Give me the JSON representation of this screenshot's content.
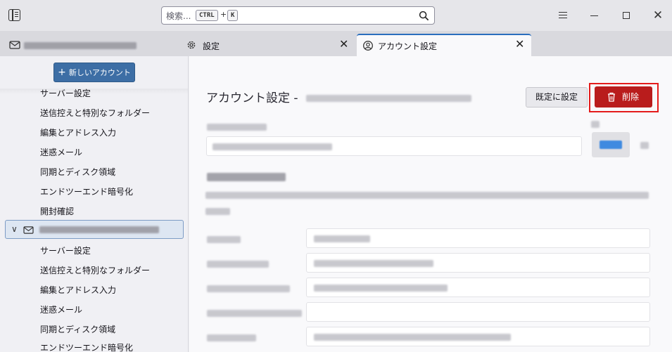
{
  "titlebar": {
    "search": {
      "placeholder": "検索...",
      "shortcut_ctrl": "CTRL",
      "shortcut_plus": "+",
      "shortcut_key": "K"
    },
    "icons": [
      "app-menu-icon",
      "search-icon",
      "hamburger-icon",
      "minimize-icon",
      "maximize-icon",
      "close-icon"
    ],
    "close_glyph": "✕"
  },
  "tabs": [
    {
      "label": "",
      "icon": "mail-account-icon",
      "close": ""
    },
    {
      "label": "設定",
      "icon": "gear-icon",
      "close": "✕"
    },
    {
      "label": "アカウント設定",
      "icon": "account-icon",
      "close": "✕",
      "active": true
    }
  ],
  "sidebar": {
    "new_account_button": "新しいアカウント",
    "plus_glyph": "+",
    "chevron": "∨",
    "group1": [
      "サーバー設定",
      "送信控えと特別なフォルダー",
      "編集とアドレス入力",
      "迷惑メール",
      "同期とディスク領域",
      "エンドツーエンド暗号化",
      "開封確認"
    ],
    "group2": [
      "サーバー設定",
      "送信控えと特別なフォルダー",
      "編集とアドレス入力",
      "迷惑メール",
      "同期とディスク領域",
      "エンドツーエンド暗号化"
    ]
  },
  "main": {
    "title": "アカウント設定 -",
    "default_button": "既定に設定",
    "delete_button": "削除",
    "accent_colors": {
      "delete": "#b91c1c",
      "highlight_outline": "#e41b1b",
      "account_color": "#3f8ae0",
      "primary": "#3d6ea5"
    }
  }
}
